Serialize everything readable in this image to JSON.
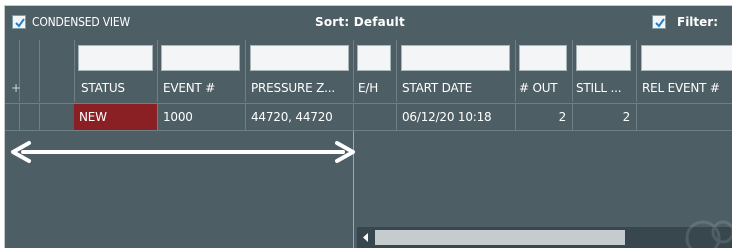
{
  "toolbar": {
    "condensed_view_label": "CONDENSED VIEW",
    "condensed_view_checked": true,
    "sort_label": "Sort:  Default",
    "filter_label": "Filter:",
    "filter_checked": true
  },
  "columns": [
    {
      "key": "plus",
      "label": "+"
    },
    {
      "key": "blank",
      "label": ""
    },
    {
      "key": "status",
      "label": "STATUS"
    },
    {
      "key": "event",
      "label": "EVENT #"
    },
    {
      "key": "pressure_zone",
      "label": "PRESSURE Z..."
    },
    {
      "key": "eh",
      "label": "E/H"
    },
    {
      "key": "start_date",
      "label": "START DATE"
    },
    {
      "key": "out",
      "label": "# OUT"
    },
    {
      "key": "still",
      "label": "STILL ..."
    },
    {
      "key": "rel_event",
      "label": "REL EVENT #"
    }
  ],
  "rows": [
    {
      "status": "NEW",
      "event": "1000",
      "pressure_zone": "44720, 44720",
      "eh": "",
      "start_date": "06/12/20 10:18",
      "out": "2",
      "still": "2",
      "rel_event": ""
    }
  ],
  "colors": {
    "panel_bg": "#4d5e65",
    "status_new_bg": "#8a1f24",
    "scroll_thumb": "#c6cbce"
  },
  "icons": {
    "resize_arrow": "double-headed-arrow-icon",
    "checkbox": "checkmark-icon",
    "scroll_left": "triangle-left-icon"
  }
}
